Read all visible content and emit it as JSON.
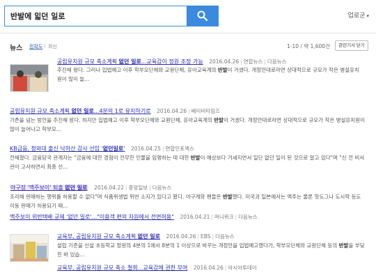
{
  "search": {
    "query": "반발에 읿던 일로",
    "button_icon": "search-icon"
  },
  "user_menu": {
    "label": "업로군",
    "caret": "▾"
  },
  "section": {
    "title": "뉴스",
    "sort_accuracy": "정확도",
    "sort_sep": "|",
    "sort_recent": "최신",
    "count": "1-10 / 약 1,600건",
    "related_button": "관련기사 닫기"
  },
  "results": [
    {
      "title_pre": "공립유치원 규모 축소계획 ",
      "title_bold": "없던 일로",
      "title_post": "...교육감이 정원 조정 가능",
      "date": "2016.04.26",
      "source": "연합뉴스",
      "via": "다음뉴스",
      "snippet_pre": "추진해 왔다. 그러나 입법예고 이후 학부모단체와 교원단체, 유아교육계의 ",
      "snippet_bold": "반발",
      "snippet_post": "이 거셌다. 개정안대로라면 상대적으로 규모가 작은 병설유치원이 많이 늘..."
    },
    {
      "title_pre": "공립유치원 규모 축소계획 ",
      "title_bold": "없던 일로",
      "title_post": "...4분의 1로 유지하기로",
      "date": "2016.04.26",
      "source": "베이비타임즈",
      "via": "",
      "snippet_pre": "기존을 넘는 방안을 추진해 왔다. 하지만 입법예고 이후 학부모단체와 교원단체, 유아교육계의 ",
      "snippet_bold": "반발",
      "snippet_post": "이 거셌다. 개정안대로라면 상대적으로 규모가 작은 병설유치원이 많이 늘어나고 학부모..."
    },
    {
      "title_pre": "KB금융, 청와대 출신 낙하산 감사 선임 '",
      "title_bold": "없던일로",
      "title_post": "'",
      "date": "2016.04.25",
      "source": "연합인포맥스",
      "via": "",
      "snippet_pre": "전해졌다. 금융당국 관계자는 \"금융에 대한 경험이 전무한 인물을 임명하는 데 대한 ",
      "snippet_bold": "반발",
      "snippet_post": "이 예상보다 거세지면서 일단 없던 일이 된 것으로 알고 있다\"며 \"신 전 비서관이 고사하면서 최종 선..."
    },
    {
      "title_pre": "야구장 '맥주보이' 퇴출 ",
      "title_bold": "없던 일로",
      "title_post": "",
      "date": "2016.04.22",
      "source": "중앙일보",
      "via": "다음뉴스",
      "snippet_pre": "조리해 판매하는 행위를 허용할 수 없다\"며 식품위생법 위반 소지가 있다고 봤다. 야구계와 팬들은 ",
      "snippet_bold": "반발",
      "snippet_post": "했다. 미국과 일본에서는 맥주는 물론 핫도그나 도시락 등도 이동 판매가 허용되기 때...",
      "related_title": "맥주보이 위반택배 규제 '없던 일로'...\"이용객 편의 차원에서 전면허용\"",
      "related_date": "2016.04.21",
      "related_source": "머니위크",
      "related_via": "다음뉴스"
    },
    {
      "title_pre": "교육부, 공립유치원 규모 축소계획 ",
      "title_bold": "없던 일로",
      "title_post": "",
      "date": "2016.04.26",
      "source": "EBS",
      "via": "다음뉴스",
      "snippet_pre": "설립 기준을 신설 초등학교 정원의 4분의 1에서 8분의 1 이상으로 바꾸는 개정안을 입법예고했다가, 학부모단체와 교원단체 등의 ",
      "snippet_bold": "반발",
      "snippet_post": "을 부딪힌 바 있습...",
      "related_title": "교육부, 공립유치원 규모 축소 철회...교육감에 권한 부여",
      "related_date": "2016.04.26",
      "related_source": "아시아투데이",
      "related_via": ""
    }
  ]
}
